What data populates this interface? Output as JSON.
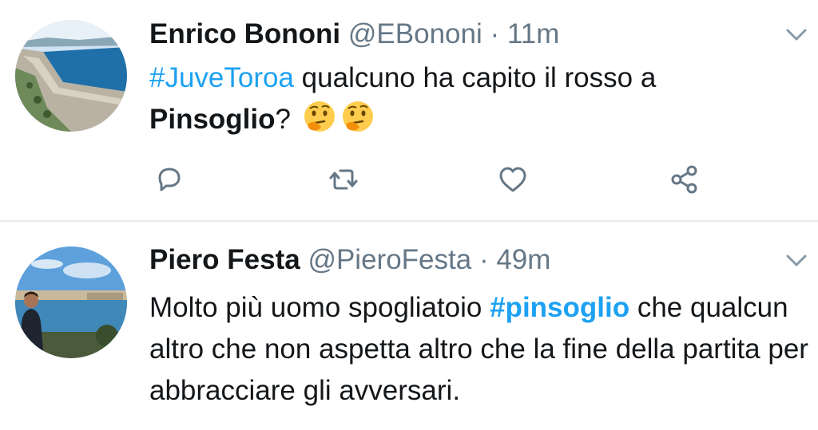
{
  "tweets": [
    {
      "author_name": "Enrico Bononi",
      "handle": "@EBononi",
      "separator": "·",
      "time": "11m",
      "body": {
        "hashtag": "#JuveToroa",
        "text_1": " qualcuno ha capito il rosso a",
        "bold_word": "Pinsoglio",
        "text_2": "?"
      },
      "emojis": [
        "thinking-face-icon",
        "thinking-face-icon"
      ],
      "actions": [
        "reply-icon",
        "retweet-icon",
        "like-icon",
        "share-icon"
      ]
    },
    {
      "author_name": "Piero Festa",
      "handle": "@PieroFesta",
      "separator": "·",
      "time": "49m",
      "body": {
        "text_1": "Molto più uomo spogliatoio ",
        "hashtag": "#pinsoglio",
        "text_2": " che qualcun altro che non aspetta altro che la fine della partita per abbracciare gli avversari."
      }
    }
  ],
  "colors": {
    "link": "#1da1f2",
    "secondary_text": "#657786",
    "icon": "#657786",
    "divider": "#e6ecf0"
  }
}
